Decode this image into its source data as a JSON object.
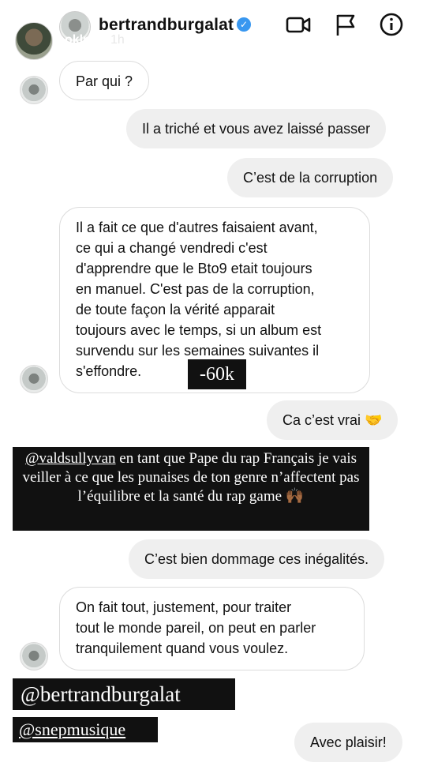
{
  "header": {
    "username": "bertrandburgalat",
    "sub_user": "oklm",
    "time": "1h",
    "icons": [
      "verified-badge-icon",
      "video-call-icon",
      "flag-icon",
      "info-icon",
      "close-icon"
    ]
  },
  "messages": [
    {
      "side": "in",
      "text": "Par qui ?"
    },
    {
      "side": "out",
      "text": "Il a triché et vous avez laissé passer"
    },
    {
      "side": "out",
      "text": "C’est de la corruption"
    },
    {
      "side": "in",
      "lines": [
        "Il a fait ce que d'autres faisaient avant,",
        "ce qui a changé vendredi c'est",
        "d'apprendre que le Bto9 etait toujours",
        "en manuel. C'est pas de la corruption,",
        "de toute façon la vérité apparait",
        "toujours avec le temps, si un album est",
        "survendu sur les semaines suivantes il",
        "s'effondre."
      ]
    },
    {
      "side": "out",
      "text": "Ca c’est vrai 🤝"
    },
    {
      "side": "out",
      "text": "C’est bien dommage ces inégalités."
    },
    {
      "side": "in",
      "lines": [
        "On fait tout, justement, pour traiter",
        "tout le monde pareil, on peut en parler",
        "tranquilement quand vous voulez."
      ]
    },
    {
      "side": "out",
      "text": "Avec plaisir!"
    }
  ],
  "overlays": {
    "tag_60k": "-60k",
    "big": {
      "mention": "@valdsullyvan",
      "rest": " en tant que Pape du rap Français je vais veiller à ce que les punaises de ton genre n’affectent pas l’équilibre et la santé du rap game 🙌🏾"
    },
    "tag_bertrand": "@bertrandburgalat",
    "tag_snep": "@snepmusique"
  }
}
